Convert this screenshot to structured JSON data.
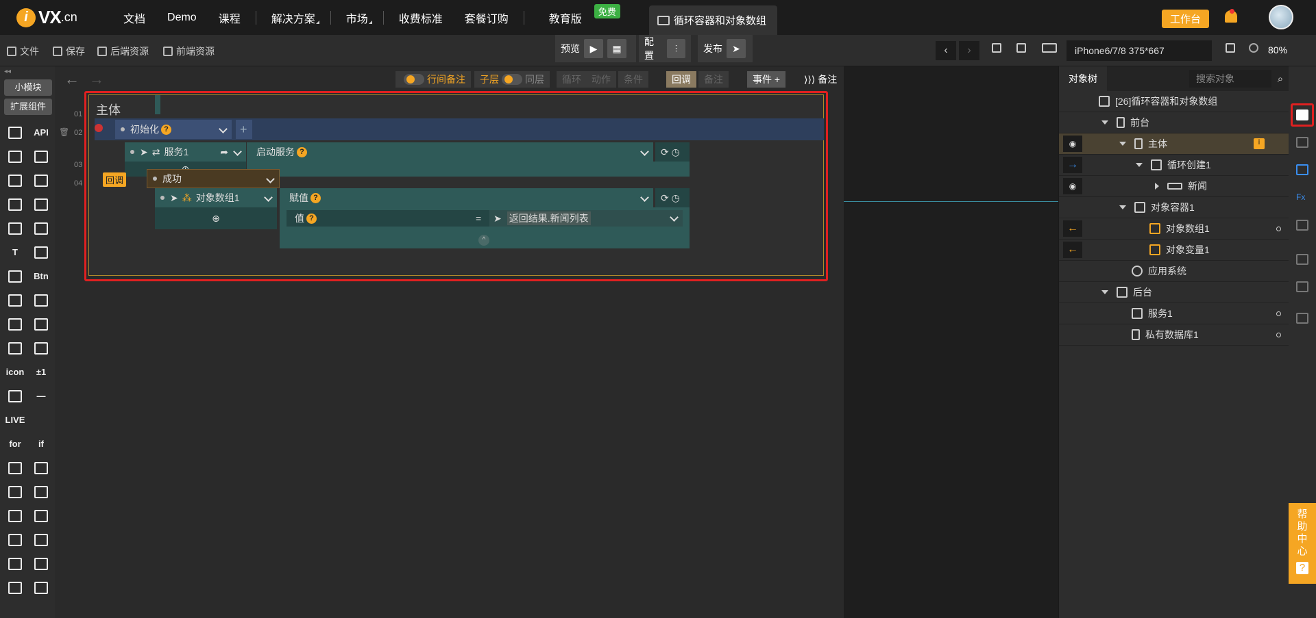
{
  "nav": {
    "logo_text": "VX",
    "logo_suffix": ".cn",
    "links": [
      "文档",
      "Demo",
      "课程",
      "解决方案",
      "市场",
      "收费标准",
      "套餐订购",
      "教育版"
    ],
    "free_badge": "免费",
    "doc_tab": "循环容器和对象数组",
    "workbench": "工作台"
  },
  "toolbar": {
    "file": "文件",
    "save": "保存",
    "backend_res": "后端资源",
    "frontend_res": "前端资源",
    "preview": "预览",
    "config": "配置",
    "publish": "发布",
    "device": "iPhone6/7/8 375*667",
    "zoom": "80%"
  },
  "leftbar": {
    "small_module": "小模块",
    "ext_component": "扩展组件",
    "icons": [
      "cube-icon",
      "API",
      "cluster-icon",
      "gear-icon",
      "download-icon",
      "upload-icon",
      "list-icon",
      "copy-icon",
      "image-icon",
      "image2-icon",
      "T",
      "translate-icon",
      "edit-icon",
      "Btn",
      "music-icon",
      "video-icon",
      "form-icon",
      "form2-icon",
      "ie-icon",
      "map-icon",
      "icon",
      "±1",
      "qr-icon",
      "—",
      "LIVE",
      "",
      "for",
      "if",
      "shuffle-icon",
      "gallery-icon",
      "dots-icon",
      "vdots-icon",
      "sliders-icon",
      "table-icon",
      "list2-icon",
      "share-icon",
      "clock-icon",
      "tune-icon",
      "hourglass-icon",
      "code-icon"
    ]
  },
  "editor": {
    "row_note": "行间备注",
    "child": "子层",
    "same": "同层",
    "loop": "循环",
    "action": "动作",
    "condition": "条件",
    "callback": "回调",
    "note": "备注",
    "event": "事件",
    "note2": "备注",
    "main_title": "主体",
    "line1": "01",
    "line2": "02",
    "line3": "03",
    "line4": "04",
    "init": "初始化",
    "service": "服务1",
    "start_service": "启动服务",
    "callback_tag": "回调",
    "success": "成功",
    "obj_array": "对象数组1",
    "assign": "赋值",
    "value_label": "值",
    "equals": "=",
    "value_expr": "返回结果.新闻列表"
  },
  "objtree": {
    "tab": "对象树",
    "search_placeholder": "搜索对象",
    "items": [
      "[26]循环容器和对象数组",
      "前台",
      "主体",
      "循环创建1",
      "新闻",
      "对象容器1",
      "对象数组1",
      "对象变量1",
      "应用系统",
      "后台",
      "服务1",
      "私有数据库1"
    ]
  },
  "help": [
    "帮",
    "助",
    "中",
    "心",
    "?"
  ]
}
